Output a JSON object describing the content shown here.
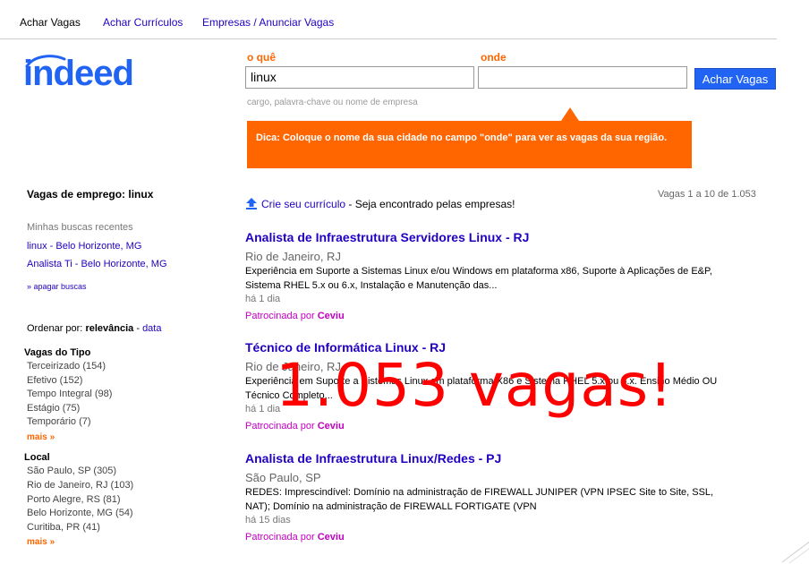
{
  "nav": {
    "items": [
      "Achar Vagas",
      "Achar Currículos",
      "Empresas / Anunciar Vagas"
    ]
  },
  "logo": {
    "text": "indeed"
  },
  "search": {
    "what_label": "o quê",
    "where_label": "onde",
    "what_value": "linux",
    "where_value": "",
    "button_label": "Achar Vagas",
    "hint": "cargo, palavra-chave ou nome de empresa"
  },
  "tip": {
    "text": "Dica: Coloque o nome da sua cidade no campo \"onde\" para ver as vagas da sua região."
  },
  "sidebar": {
    "heading_prefix": "Vagas de emprego:",
    "heading_query": "linux",
    "recent_title": "Minhas buscas recentes",
    "recent": [
      "linux - Belo Horizonte, MG",
      "Analista Ti - Belo Horizonte, MG"
    ],
    "clear_searches": "» apagar buscas",
    "sort_label": "Ordenar por:",
    "sort_active": "relevância",
    "sort_sep": "-",
    "sort_other": "data",
    "type_title": "Vagas do Tipo",
    "types": [
      "Terceirizado (154)",
      "Efetivo (152)",
      "Tempo Integral (98)",
      "Estágio (75)",
      "Temporário (7)"
    ],
    "more_label": "mais »",
    "local_title": "Local",
    "locals": [
      "São Paulo, SP (305)",
      "Rio de Janeiro, RJ (103)",
      "Porto Alegre, RS (81)",
      "Belo Horizonte, MG (54)",
      "Curitiba, PR (41)"
    ]
  },
  "results": {
    "count_text": "Vagas 1 a 10 de 1.053",
    "resume_link": "Crie seu currículo",
    "resume_rest": " - Seja encontrado pelas empresas!",
    "jobs": [
      {
        "title": "Analista de Infraestrutura Servidores Linux - RJ",
        "location": "Rio de Janeiro, RJ",
        "description": "Experiência em Suporte a Sistemas Linux e/ou Windows em plataforma x86, Suporte à Aplicações de E&P, Sistema RHEL 5.x ou 6.x, Instalação e Manutenção das...",
        "age": "há 1 dia",
        "sponsor_prefix": "Patrocinada por",
        "sponsor": "Ceviu"
      },
      {
        "title": "Técnico de Informática Linux - RJ",
        "location": "Rio de Janeiro, RJ",
        "description": "Experiência em Suporte a Sistemas Linux em plataforma X86 e Sistema RHEL 5.x ou 6.x. Ensino Médio OU Técnico Completo...",
        "age": "há 1 dia",
        "sponsor_prefix": "Patrocinada por",
        "sponsor": "Ceviu"
      },
      {
        "title": "Analista de Infraestrutura Linux/Redes - PJ",
        "location": "São Paulo, SP",
        "description": "REDES: Imprescindível: Domínio na administração de FIREWALL JUNIPER (VPN IPSEC Site to Site, SSL, NAT); Domínio na administração de FIREWALL FORTIGATE (VPN",
        "age": "há 15 dias",
        "sponsor_prefix": "Patrocinada por",
        "sponsor": "Ceviu"
      }
    ]
  },
  "overlay": {
    "text": "1.053 vagas!"
  },
  "colors": {
    "brand_blue": "#2164f3",
    "link_blue": "#2200c1",
    "orange": "#ff6600",
    "sponsor_magenta": "#c000c0",
    "overlay_red": "#ff0000"
  }
}
